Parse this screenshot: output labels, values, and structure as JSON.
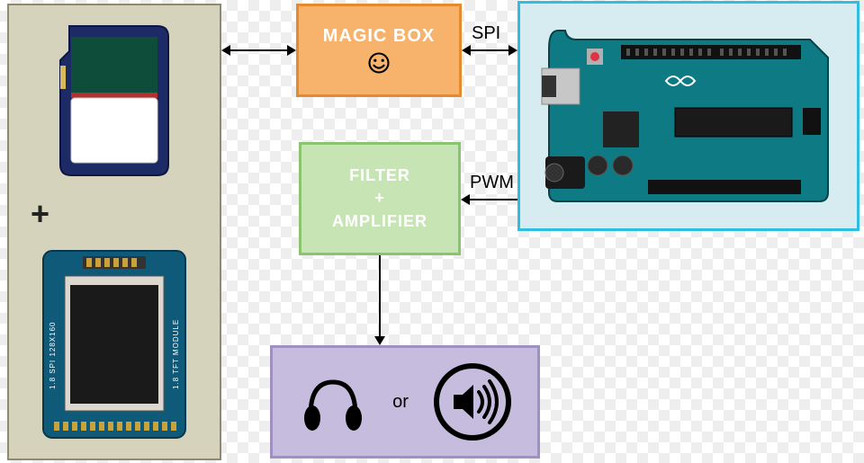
{
  "magic_box": {
    "label": "MAGIC BOX"
  },
  "filter_box": {
    "line1": "FILTER",
    "line2": "+",
    "line3": "AMPLIFIER"
  },
  "connections": {
    "spi": "SPI",
    "pwm": "PWM"
  },
  "output": {
    "or": "or"
  },
  "left_panel": {
    "plus": "+"
  },
  "tft_module": {
    "side_left": "1.8 SPI 128X160",
    "side_right": "1.8 TFT MODULE"
  }
}
